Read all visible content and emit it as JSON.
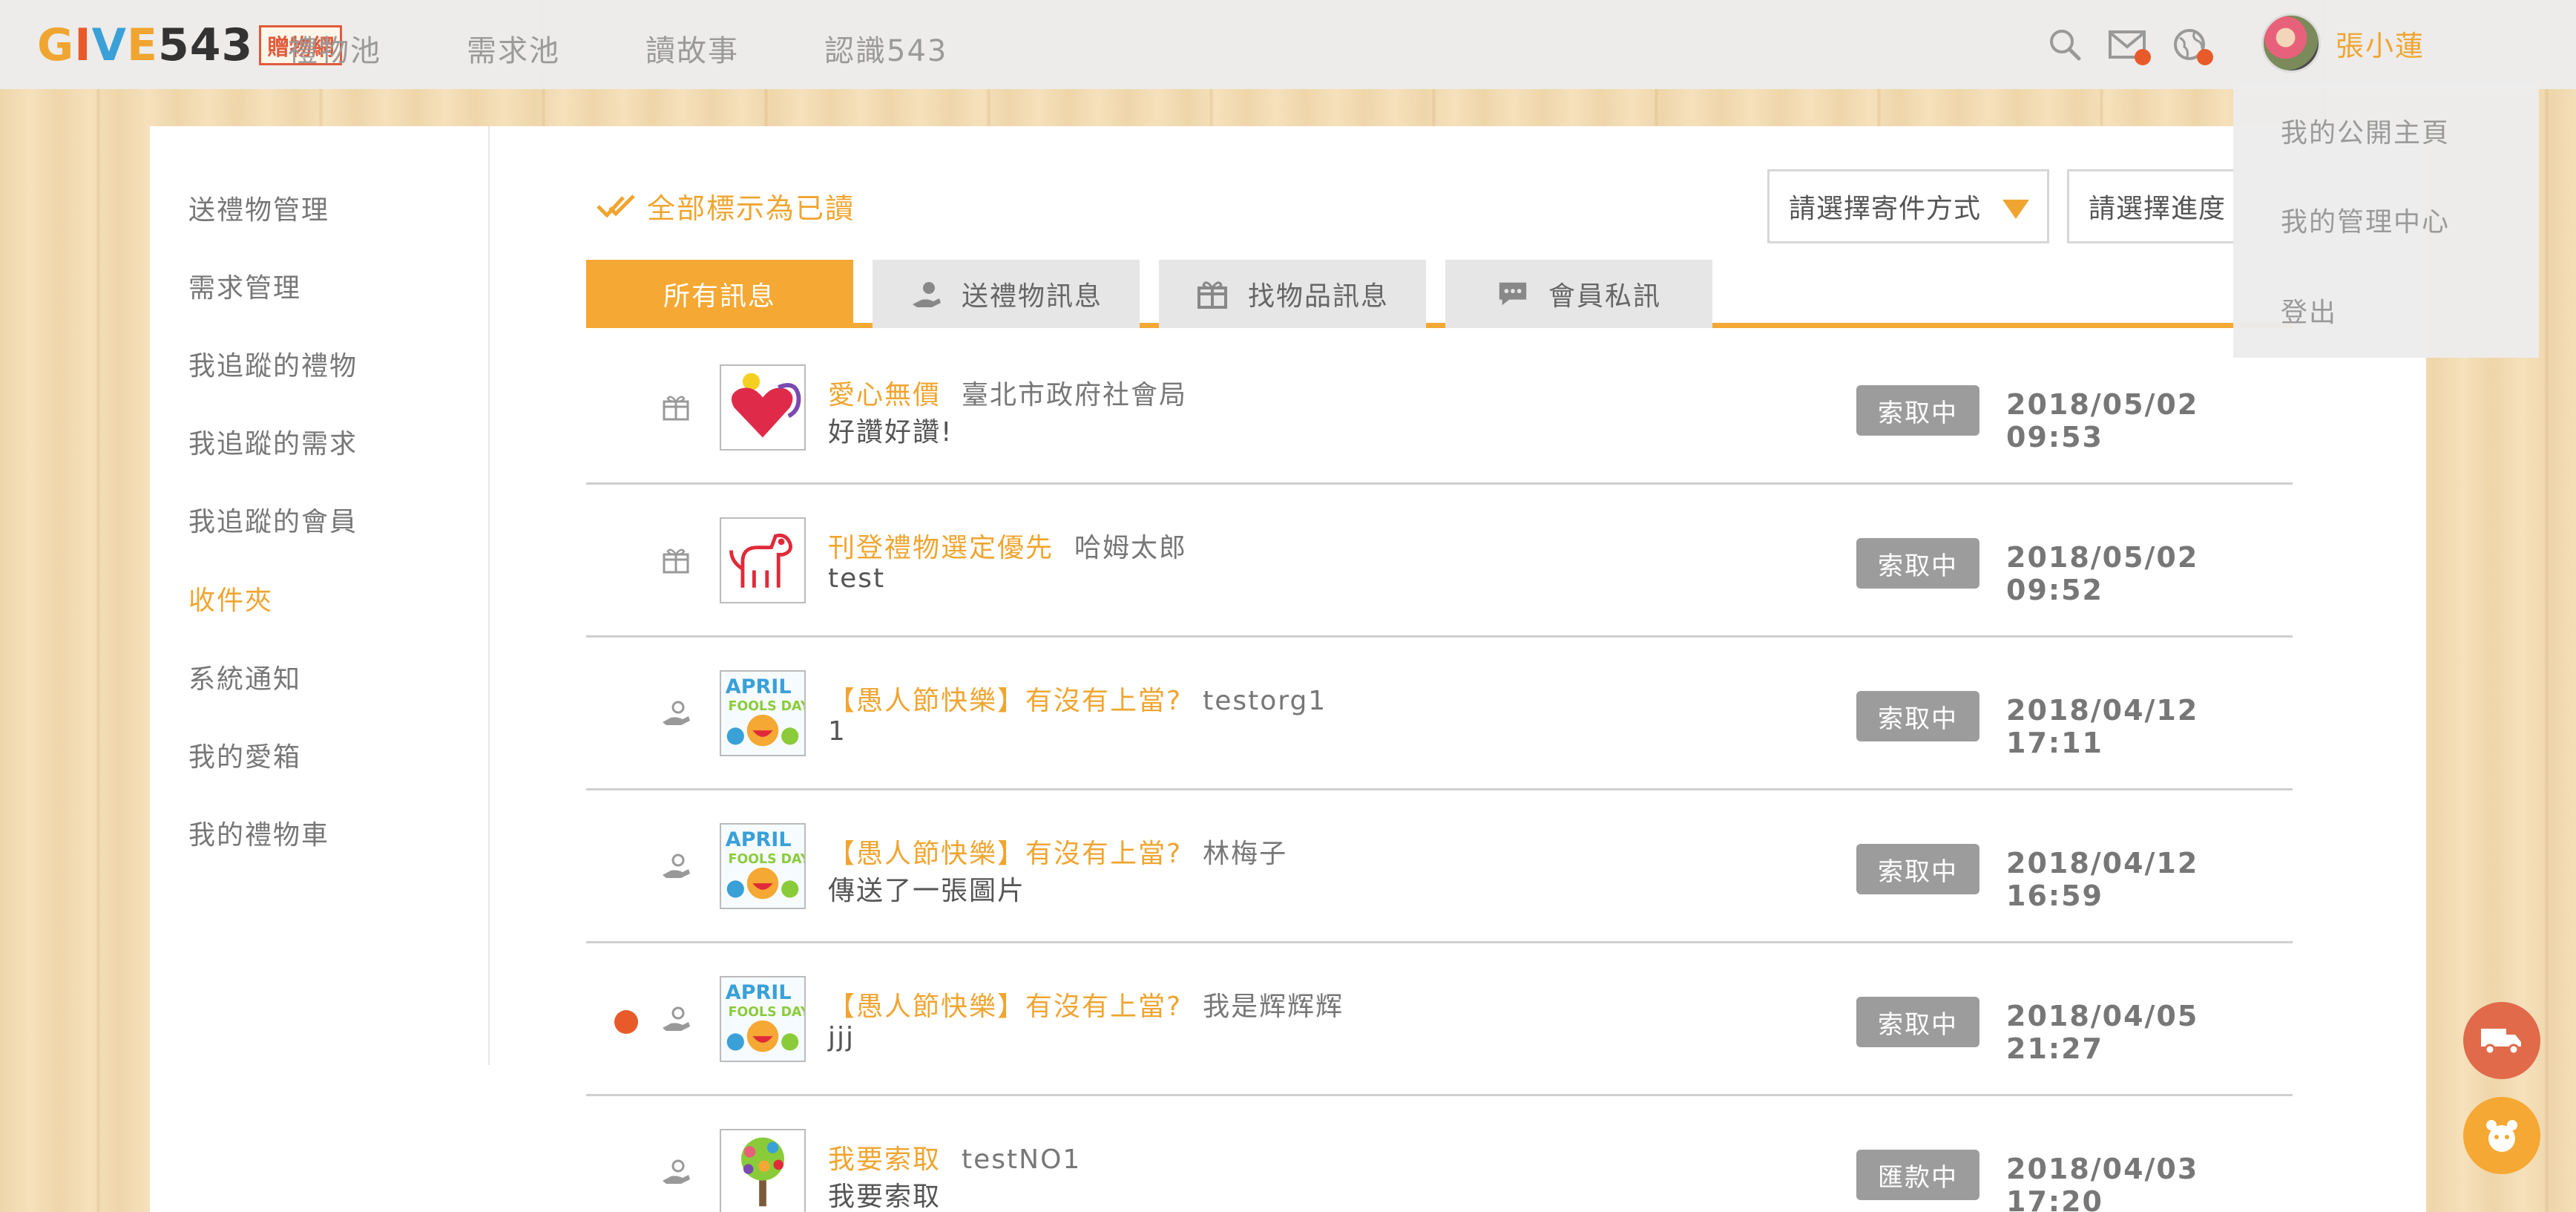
{
  "brand": {
    "logo_text": "GIVE543",
    "logo_box": "贈物網"
  },
  "nav": [
    "禮物池",
    "需求池",
    "讀故事",
    "認識543"
  ],
  "user": {
    "name": "張小蓮"
  },
  "user_menu": [
    "我的公開主頁",
    "我的管理中心",
    "登出"
  ],
  "sidebar": [
    "送禮物管理",
    "需求管理",
    "我追蹤的禮物",
    "我追蹤的需求",
    "我追蹤的會員",
    "收件夾",
    "系統通知",
    "我的愛箱",
    "我的禮物車"
  ],
  "sidebar_active_index": 5,
  "toolbar": {
    "mark_all_read": "全部標示為已讀",
    "shipping_select": "請選擇寄件方式",
    "progress_select": "請選擇進度"
  },
  "tabs": [
    "所有訊息",
    "送禮物訊息",
    "找物品訊息",
    "會員私訊"
  ],
  "messages": [
    {
      "type": "gift",
      "unread": false,
      "title": "愛心無價",
      "who": "臺北市政府社會局",
      "msg": "好讚好讚!",
      "status": "索取中",
      "time": "2018/05/02 09:53",
      "thumb": "heart"
    },
    {
      "type": "gift",
      "unread": false,
      "title": "刊登禮物選定優先",
      "who": "哈姆太郎",
      "msg": "test",
      "status": "索取中",
      "time": "2018/05/02 09:52",
      "thumb": "dog"
    },
    {
      "type": "hand",
      "unread": false,
      "title": "【愚人節快樂】有沒有上當?",
      "who": "testorg1",
      "msg": "1",
      "status": "索取中",
      "time": "2018/04/12 17:11",
      "thumb": "april"
    },
    {
      "type": "hand",
      "unread": false,
      "title": "【愚人節快樂】有沒有上當?",
      "who": "林梅子",
      "msg": "傳送了一張圖片",
      "status": "索取中",
      "time": "2018/04/12 16:59",
      "thumb": "april"
    },
    {
      "type": "hand",
      "unread": true,
      "title": "【愚人節快樂】有沒有上當?",
      "who": "我是辉辉辉",
      "msg": "jjj",
      "status": "索取中",
      "time": "2018/04/05 21:27",
      "thumb": "april"
    },
    {
      "type": "hand",
      "unread": false,
      "title": "我要索取",
      "who": "testNO1",
      "msg": "我要索取",
      "status": "匯款中",
      "time": "2018/04/03 17:20",
      "thumb": "tree"
    }
  ],
  "colors": {
    "accent": "#f5a833",
    "unread": "#e85a2a",
    "badge": "#9c9c9c"
  },
  "floating": {
    "truck_button": "truck-icon",
    "mascot_button": "mascot-icon"
  }
}
